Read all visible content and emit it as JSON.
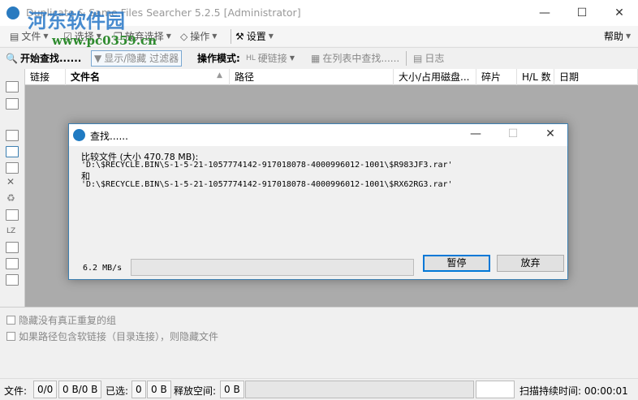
{
  "window": {
    "title": "Duplicate & Same Files Searcher 5.2.5 [Administrator]",
    "minimize": "—",
    "maximize": "☐",
    "close": "✕"
  },
  "watermark": {
    "name": "河东软件园",
    "url": "www.pc0359.cn"
  },
  "menu": {
    "file": "文件",
    "select": "选择",
    "deselect": "放弃选择",
    "actions": "操作",
    "settings": "设置",
    "help": "帮助"
  },
  "toolbar": {
    "start": "开始查找......",
    "filter": "显示/隐藏 过滤器",
    "mode_label": "操作模式:",
    "mode_value": "硬链接",
    "find_in_list": "在列表中查找......",
    "log": "日志"
  },
  "columns": [
    "链接",
    "文件名",
    "路径",
    "大小/占用磁盘...",
    "碎片",
    "H/L 数",
    "日期"
  ],
  "options": [
    "隐藏没有真正重复的组",
    "如果路径包含软链接（目录连接），则隐藏文件"
  ],
  "status": {
    "files_label": "文件:",
    "files_count": "0/0",
    "files_size": "0 B/0 B",
    "selected_label": "已选:",
    "selected_count": "0",
    "selected_size": "0 B",
    "free_label": "释放空间:",
    "free_value": "0 B",
    "duration_label": "扫描持续时间:",
    "duration_value": "00:00:01"
  },
  "dialog": {
    "title": "查找......",
    "line1": "比较文件 (大小 470.78 MB):",
    "path1": "'D:\\$RECYCLE.BIN\\S-1-5-21-1057774142-917018078-4000996012-1001\\$R983JF3.rar'",
    "and": "和",
    "path2": "'D:\\$RECYCLE.BIN\\S-1-5-21-1057774142-917018078-4000996012-1001\\$RX62RG3.rar'",
    "speed": "6.2 MB/s",
    "progress": 0,
    "pause": "暂停",
    "abort": "放弃",
    "minimize": "—",
    "maximize": "☐",
    "close": "✕"
  }
}
